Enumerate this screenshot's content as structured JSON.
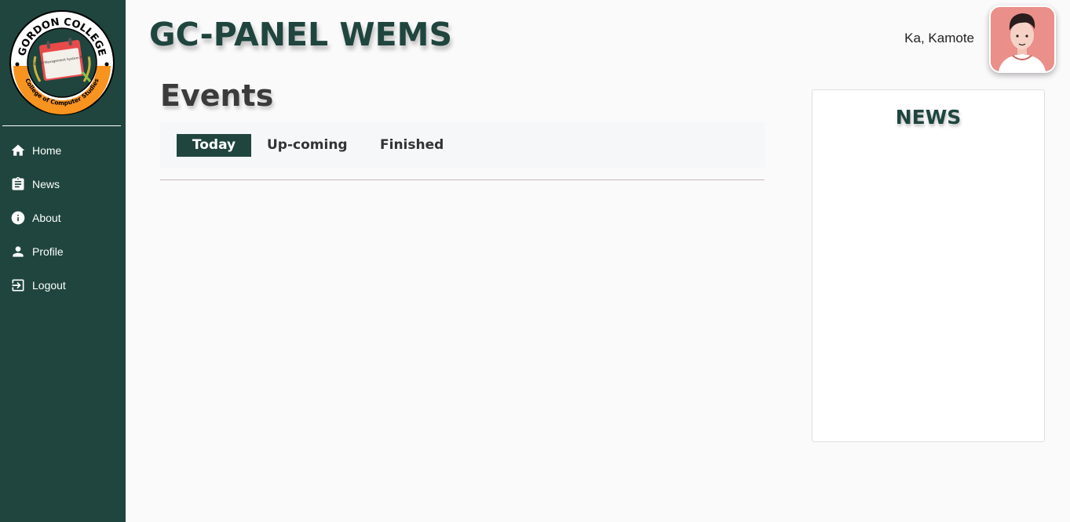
{
  "app": {
    "title": "GC-PANEL WEMS"
  },
  "logo": {
    "top_text": "GORDON COLLEGE",
    "bottom_text": "College of Computer Studies",
    "badge_text": "Event Management System Portal"
  },
  "sidebar": {
    "items": [
      {
        "label": "Home",
        "icon": "home-icon"
      },
      {
        "label": "News",
        "icon": "clipboard-icon"
      },
      {
        "label": "About",
        "icon": "info-icon"
      },
      {
        "label": "Profile",
        "icon": "person-icon"
      },
      {
        "label": "Logout",
        "icon": "logout-icon"
      }
    ]
  },
  "header": {
    "user_name": "Ka, Kamote"
  },
  "main": {
    "heading": "Events",
    "tabs": [
      {
        "label": "Today",
        "active": true
      },
      {
        "label": "Up-coming",
        "active": false
      },
      {
        "label": "Finished",
        "active": false
      }
    ]
  },
  "news": {
    "title": "NEWS"
  },
  "colors": {
    "sidebar": "#1f453e",
    "accent": "#1f453e",
    "avatar_bg": "#ea8f8a",
    "logo_orange": "#f7931e"
  }
}
